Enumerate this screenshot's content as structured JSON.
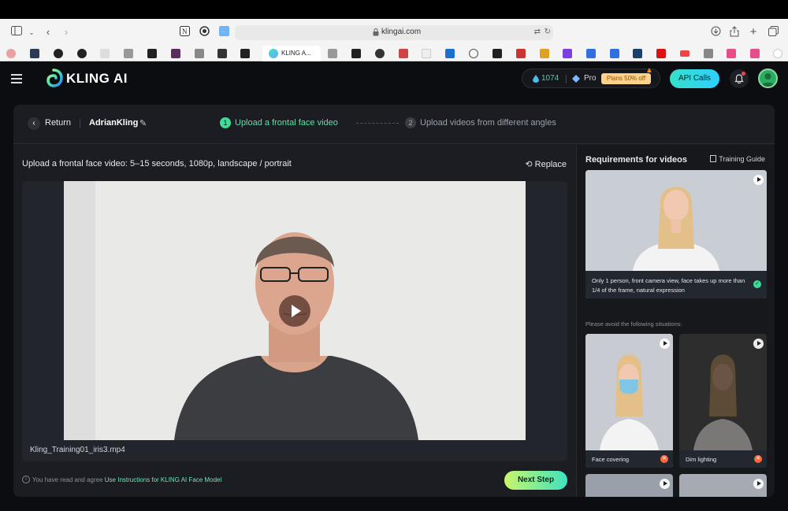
{
  "browser": {
    "url": "klingai.com",
    "active_tab_label": "KLING A..."
  },
  "header": {
    "brand": "KLING AI",
    "credits": "1074",
    "plan": "Pro",
    "plans_badge": "Plans 50% off",
    "api_calls": "API Calls"
  },
  "panel": {
    "return": "Return",
    "username": "AdrianKling",
    "step1_num": "1",
    "step1": "Upload a frontal face video",
    "step2_num": "2",
    "step2": "Upload videos from different angles"
  },
  "upload": {
    "title": "Upload a frontal face video: 5–15 seconds, 1080p, landscape / portrait",
    "replace": "Replace",
    "filename": "Kling_Training01_iris3.mp4",
    "agree_prefix": "You have read and agree ",
    "agree_link": "Use Instructions for KLING AI Face Model",
    "next": "Next Step"
  },
  "requirements": {
    "title": "Requirements for videos",
    "guide": "Training Guide",
    "good_caption": "Only 1 person, front camera view, face takes up more than 1/4 of the frame, natural expression",
    "avoid_label": "Please avoid the following situations:",
    "bad": [
      {
        "label": "Face covering"
      },
      {
        "label": "Dim lighting"
      }
    ]
  },
  "colors": {
    "accent_green": "#59e3a6",
    "background": "#0c0d11",
    "panel": "#1b1d22"
  }
}
